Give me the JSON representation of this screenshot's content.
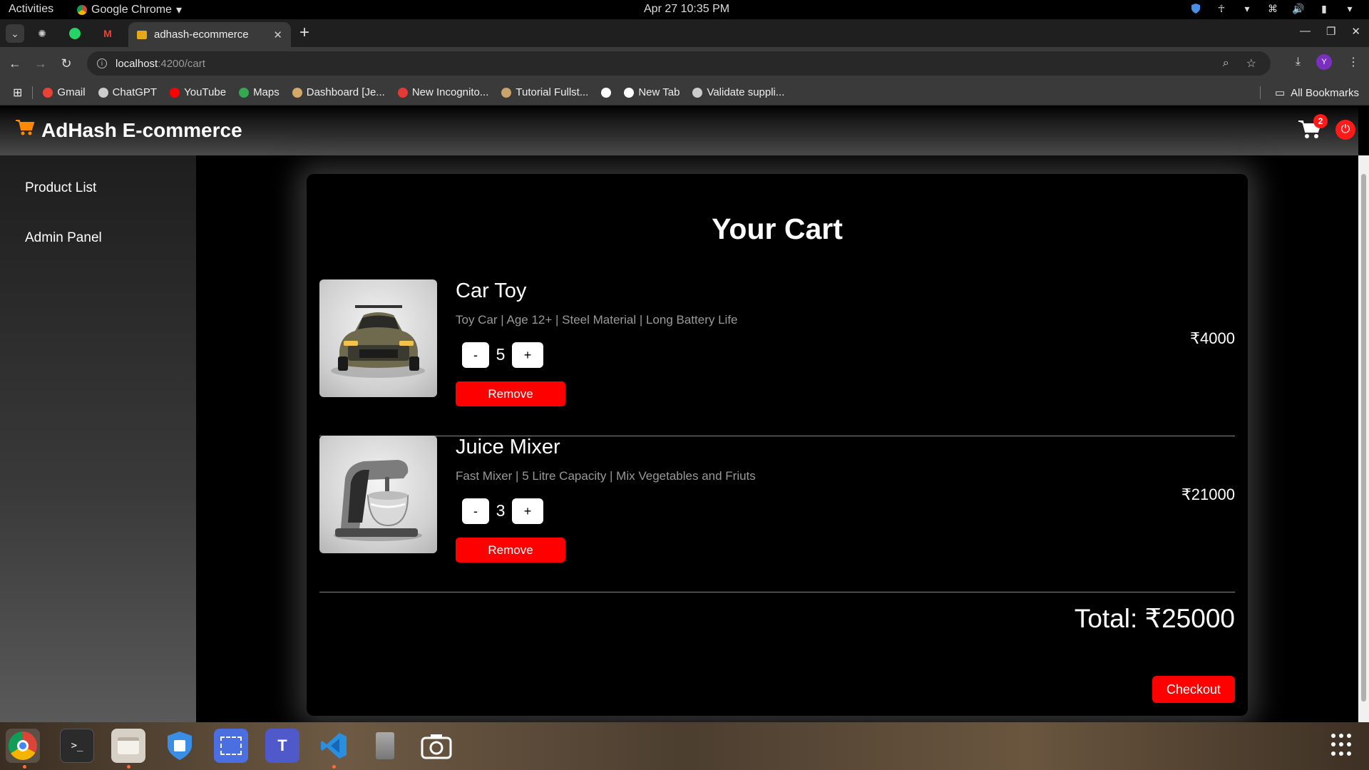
{
  "system_bar": {
    "activities": "Activities",
    "app_name": "Google Chrome",
    "clock": "Apr 27  10:35 PM"
  },
  "browser": {
    "tab_title": "adhash-ecommerce",
    "url_host": "localhost",
    "url_path": ":4200/cart",
    "profile_initial": "Y"
  },
  "bookmarks": {
    "items": [
      {
        "label": "Gmail",
        "icon": "gmail-icon",
        "color": "#ea4335"
      },
      {
        "label": "ChatGPT",
        "icon": "chatgpt-icon",
        "color": "#cccccc"
      },
      {
        "label": "YouTube",
        "icon": "youtube-icon",
        "color": "#ff0000"
      },
      {
        "label": "Maps",
        "icon": "maps-icon",
        "color": "#34a853"
      },
      {
        "label": "Dashboard [Je...",
        "icon": "jenkins-icon",
        "color": "#d4a86a"
      },
      {
        "label": "New Incognito...",
        "icon": "incognito-icon",
        "color": "#e53935"
      },
      {
        "label": "Tutorial Fullst...",
        "icon": "tutorial-icon",
        "color": "#c9a36a"
      },
      {
        "label": "",
        "icon": "globe-icon",
        "color": "#ffffff"
      },
      {
        "label": "New Tab",
        "icon": "globe-icon",
        "color": "#ffffff"
      },
      {
        "label": "Validate suppli...",
        "icon": "chatgpt-icon",
        "color": "#cccccc"
      }
    ],
    "all_bookmarks": "All Bookmarks"
  },
  "app": {
    "brand": "AdHash E-commerce",
    "cart_count": "2",
    "sidebar": [
      "Product List",
      "Admin Panel"
    ],
    "page_title": "Your Cart",
    "items": [
      {
        "name": "Car Toy",
        "description": "Toy Car | Age 12+ | Steel Material | Long Battery Life",
        "quantity": "5",
        "price": "₹4000",
        "minus": "-",
        "plus": "+",
        "remove": "Remove"
      },
      {
        "name": "Juice Mixer",
        "description": "Fast Mixer | 5 Litre Capacity | Mix Vegetables and Friuts",
        "quantity": "3",
        "price": "₹21000",
        "minus": "-",
        "plus": "+",
        "remove": "Remove"
      }
    ],
    "total": "Total: ₹25000",
    "checkout": "Checkout"
  },
  "colors": {
    "accent_red": "#ff0000",
    "brand_orange": "#ff8a00",
    "background": "#000000"
  }
}
